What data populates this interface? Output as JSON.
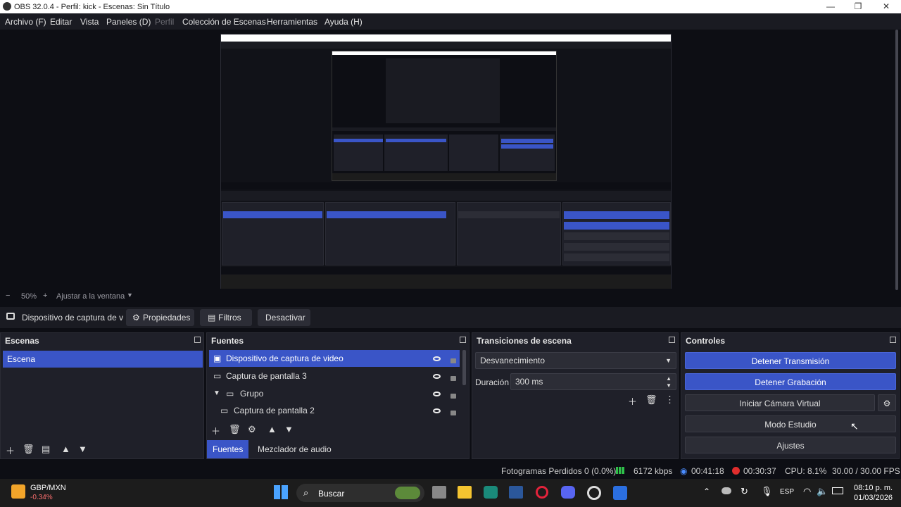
{
  "window": {
    "title": "OBS 32.0.4 - Perfil: kick - Escenas: Sin Título",
    "minimize": "—",
    "maximize": "❐",
    "close": "✕"
  },
  "menu": {
    "items": [
      "Archivo (F)",
      "Editar",
      "Vista",
      "Paneles (D)",
      "Perfil",
      "Colección de Escenas",
      "Herramientas",
      "Ayuda (H)"
    ]
  },
  "zoom": {
    "minus": "−",
    "value": "50%",
    "plus": "+",
    "fit": "Ajustar a la ventana"
  },
  "source_bar": {
    "current_source": "Dispositivo de captura de v",
    "properties": "Propiedades",
    "filters": "Filtros",
    "deactivate": "Desactivar"
  },
  "scenes": {
    "title": "Escenas",
    "items": [
      "Escena"
    ]
  },
  "sources": {
    "title": "Fuentes",
    "items": [
      "Dispositivo de captura de video",
      "Captura de pantalla 3",
      "Grupo",
      "Captura de pantalla 2"
    ]
  },
  "tabs": {
    "sources": "Fuentes",
    "mixer": "Mezclador de audio"
  },
  "transitions": {
    "title": "Transiciones de escena",
    "selected": "Desvanecimiento",
    "duration_label": "Duración",
    "duration_value": "300 ms"
  },
  "controls": {
    "title": "Controles",
    "stop_stream": "Detener Transmisión",
    "stop_record": "Detener Grabación",
    "virtual_cam": "Iniciar Cámara Virtual",
    "studio_mode": "Modo Estudio",
    "settings": "Ajustes"
  },
  "status": {
    "dropped": "Fotogramas Perdidos 0 (0.0%)",
    "kbps": "6172 kbps",
    "stream_time": "00:41:18",
    "rec_time": "00:30:37",
    "cpu": "CPU: 8.1%",
    "fps": "30.00 / 30.00 FPS"
  },
  "taskbar": {
    "ticker": "GBP/MXN",
    "change": "-0.34%",
    "search": "Buscar",
    "lang": "ESP",
    "time": "08:10 p. m.",
    "date": "01/03/2026"
  },
  "colors": {
    "accent": "#3a55c7",
    "panel": "#1f2029",
    "background": "#0d0e14",
    "recording": "#e02d2d",
    "stream_ok": "#2fbf4a"
  }
}
